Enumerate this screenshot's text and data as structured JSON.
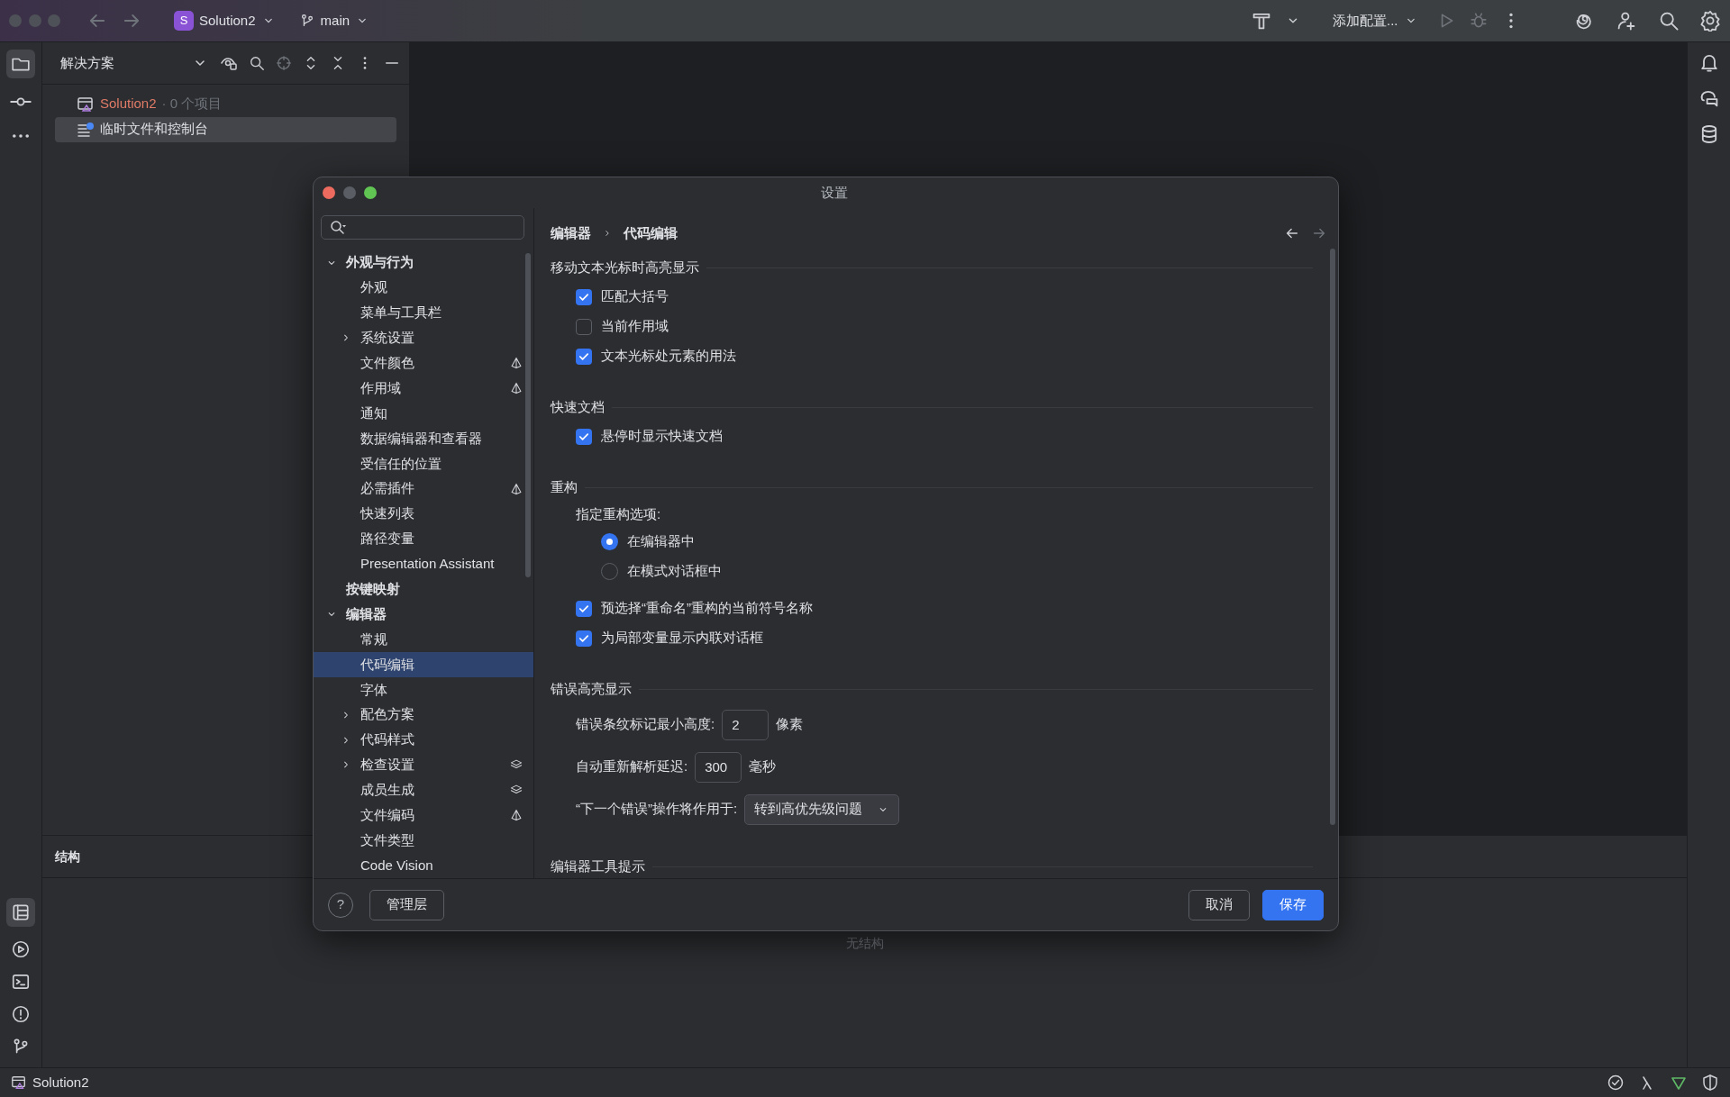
{
  "titlebar": {
    "project": {
      "initial": "S",
      "name": "Solution2"
    },
    "branch": "main",
    "run_config": "添加配置..."
  },
  "project_panel": {
    "title": "解决方案",
    "tree": [
      {
        "label": "Solution2",
        "suffix": "· 0 个项目",
        "selected": false
      },
      {
        "label": "临时文件和控制台",
        "selected": true
      }
    ]
  },
  "structure_panel": {
    "title": "结构",
    "empty_text": "无结构"
  },
  "status_bar": {
    "project": "Solution2"
  },
  "dialog": {
    "title": "设置",
    "nav": [
      {
        "label": "外观与行为",
        "expanded": true,
        "selected": false,
        "children": [
          {
            "kind": "plain",
            "label": "外观",
            "selected": false
          },
          {
            "kind": "plain",
            "label": "菜单与工具栏",
            "selected": false
          },
          {
            "kind": "plain",
            "label": "系统设置",
            "expanded": false,
            "selected": false
          },
          {
            "kind": "ide",
            "label": "文件颜色",
            "selected": false
          },
          {
            "kind": "ide",
            "label": "作用域",
            "selected": false
          },
          {
            "kind": "plain",
            "label": "通知",
            "selected": false
          },
          {
            "kind": "plain",
            "label": "数据编辑器和查看器",
            "selected": false
          },
          {
            "kind": "plain",
            "label": "受信任的位置",
            "selected": false
          },
          {
            "kind": "ide",
            "label": "必需插件",
            "selected": false
          },
          {
            "kind": "plain",
            "label": "快速列表",
            "selected": false
          },
          {
            "kind": "plain",
            "label": "路径变量",
            "selected": false
          },
          {
            "kind": "plain",
            "label": "Presentation Assistant",
            "selected": false
          }
        ]
      },
      {
        "label": "按键映射",
        "selected": false
      },
      {
        "label": "编辑器",
        "expanded": true,
        "selected": false,
        "children": [
          {
            "kind": "plain",
            "label": "常规",
            "selected": false
          },
          {
            "kind": "plain",
            "label": "代码编辑",
            "selected": true
          },
          {
            "kind": "plain",
            "label": "字体",
            "selected": false
          },
          {
            "kind": "plain",
            "label": "配色方案",
            "expanded": false,
            "selected": false
          },
          {
            "kind": "plain",
            "label": "代码样式",
            "expanded": false,
            "selected": false
          },
          {
            "kind": "project",
            "label": "检查设置",
            "expanded": false,
            "selected": false
          },
          {
            "kind": "project",
            "label": "成员生成",
            "selected": false
          },
          {
            "kind": "ide",
            "label": "文件编码",
            "selected": false
          },
          {
            "kind": "plain",
            "label": "文件类型",
            "selected": false
          },
          {
            "kind": "plain",
            "label": "Code Vision",
            "selected": false
          }
        ]
      }
    ],
    "breadcrumb": [
      "编辑器",
      "代码编辑"
    ],
    "sections": [
      {
        "title": "移动文本光标时高亮显示",
        "items": [
          {
            "kind": "checkbox",
            "label": "匹配大括号",
            "checked": true
          },
          {
            "kind": "checkbox",
            "label": "当前作用域",
            "checked": false
          },
          {
            "kind": "checkbox",
            "label": "文本光标处元素的用法",
            "checked": true
          }
        ]
      },
      {
        "title": "快速文档",
        "items": [
          {
            "kind": "checkbox",
            "label": "悬停时显示快速文档",
            "checked": true
          }
        ]
      },
      {
        "title": "重构",
        "items": [
          {
            "kind": "radio",
            "label": "指定重构选项:",
            "options": [
              {
                "label": "在编辑器中",
                "selected": true
              },
              {
                "label": "在模式对话框中",
                "selected": false
              }
            ]
          },
          {
            "kind": "checkbox",
            "label": "预选择“重命名”重构的当前符号名称",
            "checked": true
          },
          {
            "kind": "checkbox",
            "label": "为局部变量显示内联对话框",
            "checked": true
          }
        ]
      },
      {
        "title": "错误高亮显示",
        "items": [
          {
            "kind": "number",
            "label": "错误条纹标记最小高度:",
            "value": "2",
            "unit": "像素"
          },
          {
            "kind": "number",
            "label": "自动重新解析延迟:",
            "value": "300",
            "unit": "毫秒"
          },
          {
            "kind": "select",
            "label": "“下一个错误”操作将作用于:",
            "value": "转到高优先级问题"
          }
        ]
      },
      {
        "title": "编辑器工具提示"
      }
    ],
    "buttons": [
      {
        "kind": "help",
        "label": "?"
      },
      {
        "kind": "plain",
        "label": "管理层"
      },
      {
        "kind": "cancel",
        "label": "取消"
      },
      {
        "kind": "primary",
        "label": "保存"
      }
    ]
  }
}
